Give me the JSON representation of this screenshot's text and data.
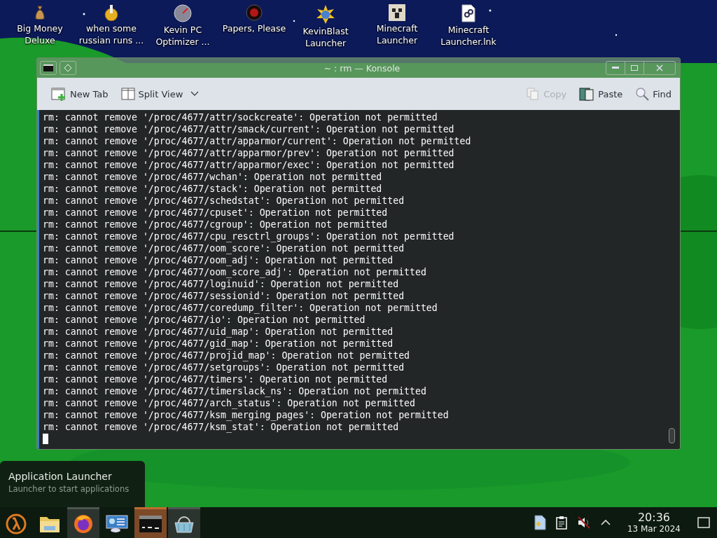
{
  "desktop_icons": [
    {
      "label": "Big Money\nDeluxe",
      "kind": "moneybag"
    },
    {
      "label": "when some\nrussian runs ...",
      "kind": "gear"
    },
    {
      "label": "Kevin PC\nOptimizer ...",
      "kind": "gauge"
    },
    {
      "label": "Papers, Please",
      "kind": "seal"
    },
    {
      "label": "KevinBlast\nLauncher",
      "kind": "burst"
    },
    {
      "label": "Minecraft\nLauncher",
      "kind": "block"
    },
    {
      "label": "Minecraft\nLauncher.lnk",
      "kind": "shortcut"
    }
  ],
  "window": {
    "title": "~ : rm — Konsole",
    "toolbar_left": [
      {
        "label": "New Tab",
        "kind": "newtab",
        "disabled": false
      },
      {
        "label": "Split View",
        "kind": "split",
        "disabled": false
      }
    ],
    "toolbar_right": [
      {
        "label": "Copy",
        "kind": "copy",
        "disabled": true
      },
      {
        "label": "Paste",
        "kind": "paste",
        "disabled": false
      },
      {
        "label": "Find",
        "kind": "find",
        "disabled": false
      }
    ],
    "terminal_lines": [
      "rm: cannot remove '/proc/4677/attr/sockcreate': Operation not permitted",
      "rm: cannot remove '/proc/4677/attr/smack/current': Operation not permitted",
      "rm: cannot remove '/proc/4677/attr/apparmor/current': Operation not permitted",
      "rm: cannot remove '/proc/4677/attr/apparmor/prev': Operation not permitted",
      "rm: cannot remove '/proc/4677/attr/apparmor/exec': Operation not permitted",
      "rm: cannot remove '/proc/4677/wchan': Operation not permitted",
      "rm: cannot remove '/proc/4677/stack': Operation not permitted",
      "rm: cannot remove '/proc/4677/schedstat': Operation not permitted",
      "rm: cannot remove '/proc/4677/cpuset': Operation not permitted",
      "rm: cannot remove '/proc/4677/cgroup': Operation not permitted",
      "rm: cannot remove '/proc/4677/cpu_resctrl_groups': Operation not permitted",
      "rm: cannot remove '/proc/4677/oom_score': Operation not permitted",
      "rm: cannot remove '/proc/4677/oom_adj': Operation not permitted",
      "rm: cannot remove '/proc/4677/oom_score_adj': Operation not permitted",
      "rm: cannot remove '/proc/4677/loginuid': Operation not permitted",
      "rm: cannot remove '/proc/4677/sessionid': Operation not permitted",
      "rm: cannot remove '/proc/4677/coredump_filter': Operation not permitted",
      "rm: cannot remove '/proc/4677/io': Operation not permitted",
      "rm: cannot remove '/proc/4677/uid_map': Operation not permitted",
      "rm: cannot remove '/proc/4677/gid_map': Operation not permitted",
      "rm: cannot remove '/proc/4677/projid_map': Operation not permitted",
      "rm: cannot remove '/proc/4677/setgroups': Operation not permitted",
      "rm: cannot remove '/proc/4677/timers': Operation not permitted",
      "rm: cannot remove '/proc/4677/timerslack_ns': Operation not permitted",
      "rm: cannot remove '/proc/4677/arch_status': Operation not permitted",
      "rm: cannot remove '/proc/4677/ksm_merging_pages': Operation not permitted",
      "rm: cannot remove '/proc/4677/ksm_stat': Operation not permitted"
    ]
  },
  "tooltip": {
    "title": "Application Launcher",
    "subtitle": "Launcher to start applications"
  },
  "taskbar": {
    "tasks": [
      {
        "kind": "launcher",
        "running": false,
        "selected": false
      },
      {
        "kind": "folder",
        "running": false,
        "selected": false
      },
      {
        "kind": "browser",
        "running": true,
        "selected": false
      },
      {
        "kind": "monitor",
        "running": false,
        "selected": false
      },
      {
        "kind": "terminal",
        "running": true,
        "selected": true
      },
      {
        "kind": "basket",
        "running": true,
        "selected": false
      }
    ],
    "tray": [
      {
        "kind": "document"
      },
      {
        "kind": "clipboard"
      },
      {
        "kind": "muted"
      },
      {
        "kind": "chevron"
      }
    ],
    "time": "20:36",
    "date": "13 Mar 2024"
  }
}
